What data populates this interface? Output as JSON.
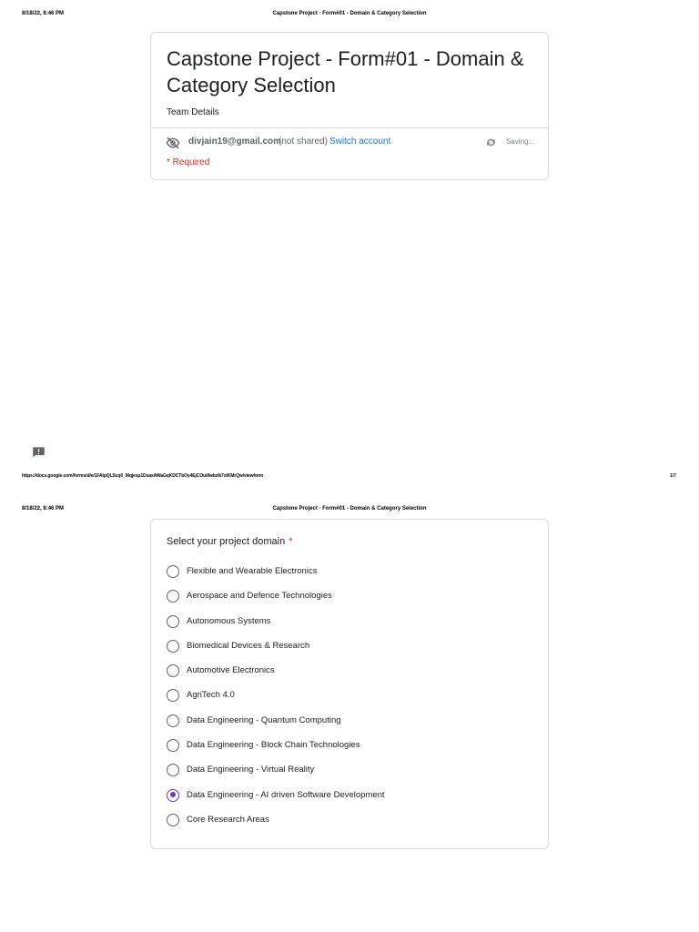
{
  "print": {
    "date": "8/18/22, 8:46 PM",
    "doc_title": "Capstone Project - Form#01 - Domain & Category Selection",
    "url": "https://docs.google.com/forms/d/e/1FAIpQLScq0_Mqjesp1DsaxAWaGqKDCTbOy4EjCOuillwbzlk7xIKMrQw/viewform",
    "page": "1/7"
  },
  "form": {
    "title": "Capstone Project - Form#01 -  Domain & Category Selection",
    "description": "Team Details",
    "account": {
      "email": "divjain19@gmail.com",
      "not_shared": "(not shared)",
      "switch_label": "Switch account",
      "saving_status": "Saving..."
    },
    "required_note": "* Required"
  },
  "question": {
    "title": "Select your project domain",
    "required_marker": "*",
    "options": [
      {
        "label": "Flexible and Wearable Electronics",
        "checked": false
      },
      {
        "label": "Aerospace and Defence Technologies",
        "checked": false
      },
      {
        "label": "Autonomous Systems",
        "checked": false
      },
      {
        "label": "Biomedical Devices & Research",
        "checked": false
      },
      {
        "label": "Automotive Electronics",
        "checked": false
      },
      {
        "label": "AgriTech 4.0",
        "checked": false
      },
      {
        "label": "Data Engineering - Quantum Computing",
        "checked": false
      },
      {
        "label": "Data Engineering - Block Chain Technologies",
        "checked": false
      },
      {
        "label": "Data Engineering - Virtual Reality",
        "checked": false
      },
      {
        "label": "Data Engineering - AI driven Software Development",
        "checked": true
      },
      {
        "label": "Core Research Areas",
        "checked": false
      }
    ]
  },
  "icons": {
    "eye_off": "eye-off-icon",
    "sync": "sync-icon",
    "feedback": "feedback-icon"
  },
  "colors": {
    "accent": "#673ab7",
    "link": "#1a73e8",
    "required": "#d93025"
  }
}
